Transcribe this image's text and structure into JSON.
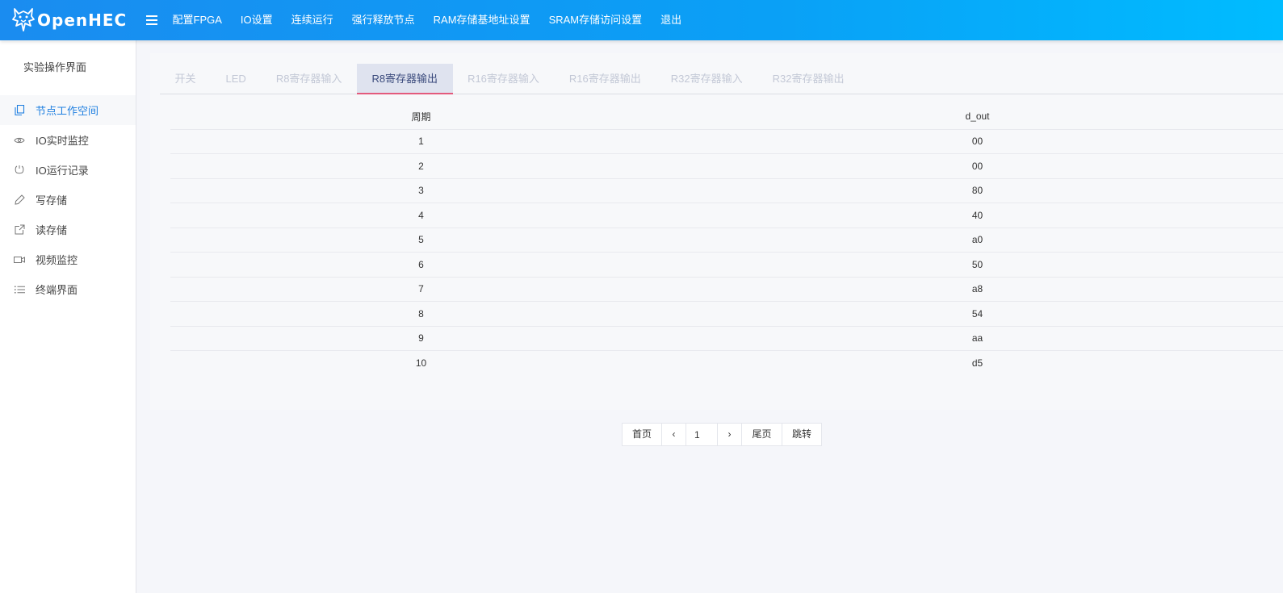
{
  "header": {
    "logo_text": "OpenHEC",
    "nav": [
      {
        "label": "配置FPGA"
      },
      {
        "label": "IO设置"
      },
      {
        "label": "连续运行"
      },
      {
        "label": "强行释放节点"
      },
      {
        "label": "RAM存储基地址设置"
      },
      {
        "label": "SRAM存储访问设置"
      },
      {
        "label": "退出"
      }
    ]
  },
  "sidebar": {
    "title": "实验操作界面",
    "items": [
      {
        "label": "节点工作空间",
        "icon": "copy-icon",
        "active": true
      },
      {
        "label": "IO实时监控",
        "icon": "eye-icon"
      },
      {
        "label": "IO运行记录",
        "icon": "mouse-icon"
      },
      {
        "label": "写存储",
        "icon": "pencil-icon"
      },
      {
        "label": "读存储",
        "icon": "share-icon"
      },
      {
        "label": "视频监控",
        "icon": "video-icon"
      },
      {
        "label": "终端界面",
        "icon": "list-icon"
      }
    ]
  },
  "tabs": [
    {
      "label": "开关"
    },
    {
      "label": "LED"
    },
    {
      "label": "R8寄存器输入"
    },
    {
      "label": "R8寄存器输出",
      "active": true
    },
    {
      "label": "R16寄存器输入"
    },
    {
      "label": "R16寄存器输出"
    },
    {
      "label": "R32寄存器输入"
    },
    {
      "label": "R32寄存器输出"
    }
  ],
  "table": {
    "headers": [
      "周期",
      "d_out"
    ],
    "rows": [
      [
        "1",
        "00"
      ],
      [
        "2",
        "00"
      ],
      [
        "3",
        "80"
      ],
      [
        "4",
        "40"
      ],
      [
        "5",
        "a0"
      ],
      [
        "6",
        "50"
      ],
      [
        "7",
        "a8"
      ],
      [
        "8",
        "54"
      ],
      [
        "9",
        "aa"
      ],
      [
        "10",
        "d5"
      ]
    ]
  },
  "pagination": {
    "first": "首页",
    "prev": "‹",
    "page_value": "1",
    "next": "›",
    "last": "尾页",
    "jump": "跳转"
  },
  "colors": {
    "header_gradient_start": "#1a8cf0",
    "header_gradient_end": "#00bcff",
    "active_side_text": "#1f7fe0",
    "active_tab_underline": "#e35a7c"
  }
}
